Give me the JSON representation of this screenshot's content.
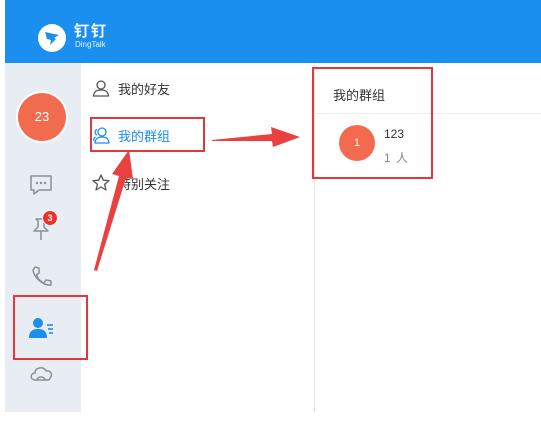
{
  "app": {
    "title": "钉钉",
    "subtitle": "DingTalk",
    "brand_color": "#1b8ff0"
  },
  "user": {
    "avatar_text": "23"
  },
  "sidebar": {
    "items": [
      {
        "icon": "chat-icon"
      },
      {
        "icon": "pin-icon",
        "badge": "3"
      },
      {
        "icon": "phone-icon"
      },
      {
        "icon": "contacts-icon",
        "active": true
      },
      {
        "icon": "cloud-icon"
      }
    ]
  },
  "contacts_menu": {
    "items": [
      {
        "label": "我的好友",
        "icon": "friend-icon"
      },
      {
        "label": "我的群组",
        "icon": "group-icon",
        "active": true
      },
      {
        "label": "特别关注",
        "icon": "star-icon"
      }
    ]
  },
  "groups": {
    "title": "我的群组",
    "list": [
      {
        "avatar_text": "1",
        "name": "123",
        "count": "1 人"
      }
    ]
  },
  "annotation_color": "#e0393b"
}
